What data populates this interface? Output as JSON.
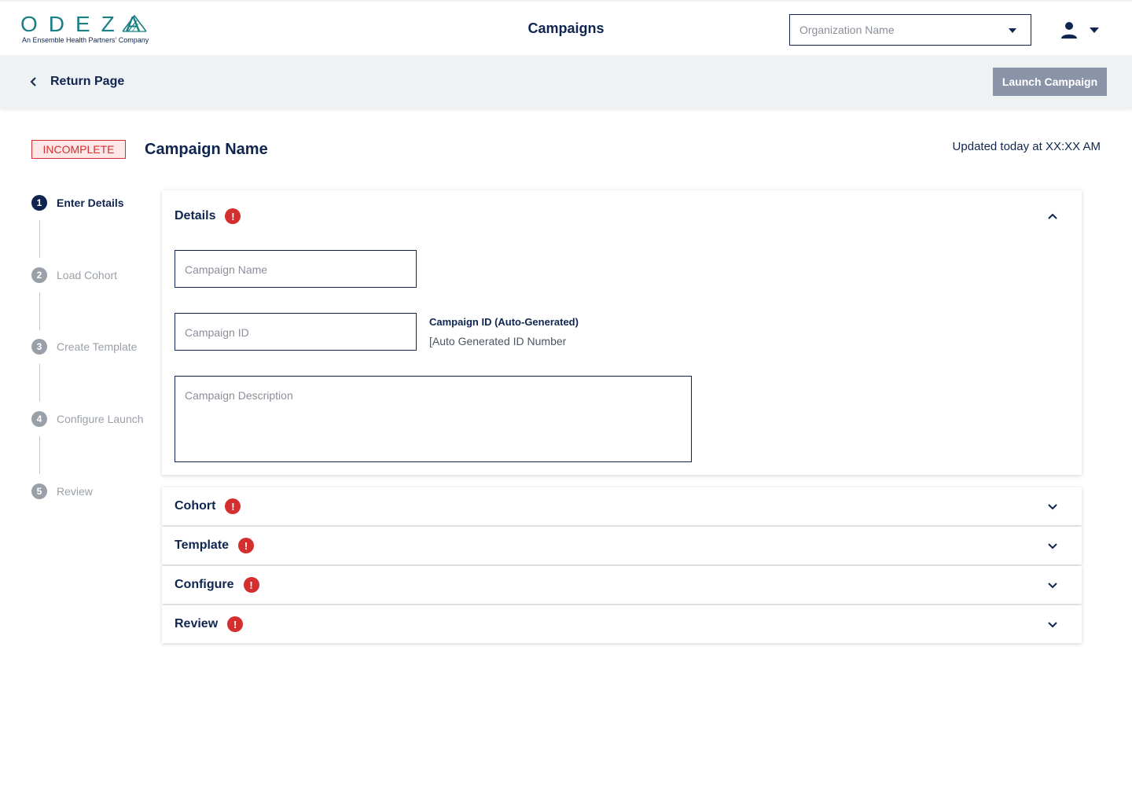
{
  "header": {
    "logo_word": "ODEZA",
    "logo_tagline": "An Ensemble Health Partners' Company",
    "title": "Campaigns",
    "org_select_placeholder": "Organization Name"
  },
  "subbar": {
    "return_label": "Return Page",
    "launch_label": "Launch Campaign"
  },
  "campaign": {
    "status": "INCOMPLETE",
    "name": "Campaign Name",
    "updated": "Updated today at XX:XX AM"
  },
  "steps": [
    {
      "num": "1",
      "label": "Enter Details",
      "active": true
    },
    {
      "num": "2",
      "label": "Load Cohort",
      "active": false
    },
    {
      "num": "3",
      "label": "Create Template",
      "active": false
    },
    {
      "num": "4",
      "label": "Configure Launch",
      "active": false
    },
    {
      "num": "5",
      "label": "Review",
      "active": false
    }
  ],
  "details": {
    "title": "Details",
    "alert": "!",
    "name_placeholder": "Campaign Name",
    "id_placeholder": "Campaign ID",
    "id_label": "Campaign ID (Auto-Generated)",
    "id_value": "[Auto Generated ID Number",
    "description_placeholder": "Campaign Description"
  },
  "sections": [
    {
      "title": "Cohort",
      "alert": "!"
    },
    {
      "title": "Template",
      "alert": "!"
    },
    {
      "title": "Configure",
      "alert": "!"
    },
    {
      "title": "Review",
      "alert": "!"
    }
  ],
  "colors": {
    "navy": "#0f2550",
    "teal": "#1b7f86",
    "error": "#d32f2f",
    "button_disabled": "#8a93a8",
    "subbar_bg": "#eff2f5"
  }
}
